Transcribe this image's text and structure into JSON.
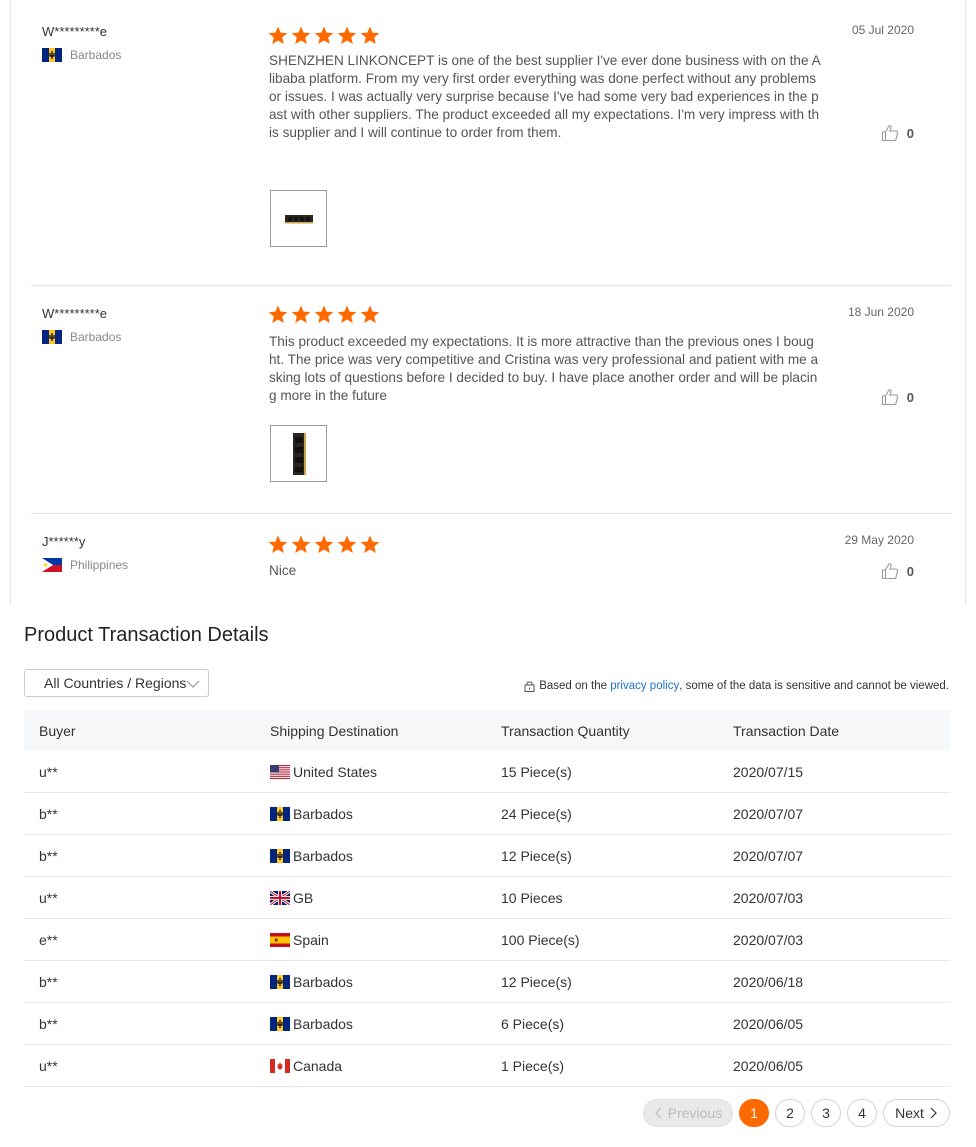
{
  "reviews": [
    {
      "name": "W*********e",
      "country": "Barbados",
      "rating": 5,
      "date": "05 Jul 2020",
      "likes": "0",
      "text": "SHENZHEN LINKONCEPT is one of the best supplier I've ever done business with on the Alibaba platform. From my very first order everything was done perfect without any problems or issues. I was actually very surprise because I've had some very bad experiences in the past with other suppliers. The product exceeded all my expectations. I'm very impress with this supplier and I will continue to order from them."
    },
    {
      "name": "W*********e",
      "country": "Barbados",
      "rating": 5,
      "date": "18 Jun 2020",
      "likes": "0",
      "text": "This product exceeded my expectations. It is more attractive than the previous ones I bought. The price was very competitive and Cristina was very professional and patient with me asking lots of questions before I decided to buy. I have place another order and will be placing more in the future"
    },
    {
      "name": "J******y",
      "country": "Philippines",
      "rating": 5,
      "date": "29 May 2020",
      "likes": "0",
      "text": "Nice"
    }
  ],
  "transactions": {
    "title": "Product Transaction Details",
    "filter_label": "All Countries / Regions",
    "privacy": {
      "prefix": "Based on the ",
      "link": "privacy policy",
      "suffix": ", some of the data is sensitive and cannot be viewed."
    },
    "headers": [
      "Buyer",
      "Shipping Destination",
      "Transaction Quantity",
      "Transaction Date"
    ],
    "rows": [
      {
        "buyer": "u**",
        "flag": "us",
        "destination": "United States",
        "quantity": "15 Piece(s)",
        "date": "2020/07/15"
      },
      {
        "buyer": "b**",
        "flag": "bb",
        "destination": "Barbados",
        "quantity": "24 Piece(s)",
        "date": "2020/07/07"
      },
      {
        "buyer": "b**",
        "flag": "bb",
        "destination": "Barbados",
        "quantity": "12 Piece(s)",
        "date": "2020/07/07"
      },
      {
        "buyer": "u**",
        "flag": "gb",
        "destination": "GB",
        "quantity": "10 Pieces",
        "date": "2020/07/03"
      },
      {
        "buyer": "e**",
        "flag": "es",
        "destination": "Spain",
        "quantity": "100 Piece(s)",
        "date": "2020/07/03"
      },
      {
        "buyer": "b**",
        "flag": "bb",
        "destination": "Barbados",
        "quantity": "12 Piece(s)",
        "date": "2020/06/18"
      },
      {
        "buyer": "b**",
        "flag": "bb",
        "destination": "Barbados",
        "quantity": "6 Piece(s)",
        "date": "2020/06/05"
      },
      {
        "buyer": "u**",
        "flag": "ca",
        "destination": "Canada",
        "quantity": "1 Piece(s)",
        "date": "2020/06/05"
      }
    ]
  },
  "pagination": {
    "previous_label": "Previous",
    "next_label": "Next",
    "pages": [
      "1",
      "2",
      "3",
      "4"
    ],
    "current": "1"
  },
  "colors": {
    "star": "#ff6a00",
    "accent": "#ff6a00",
    "link": "#1a73c7"
  }
}
